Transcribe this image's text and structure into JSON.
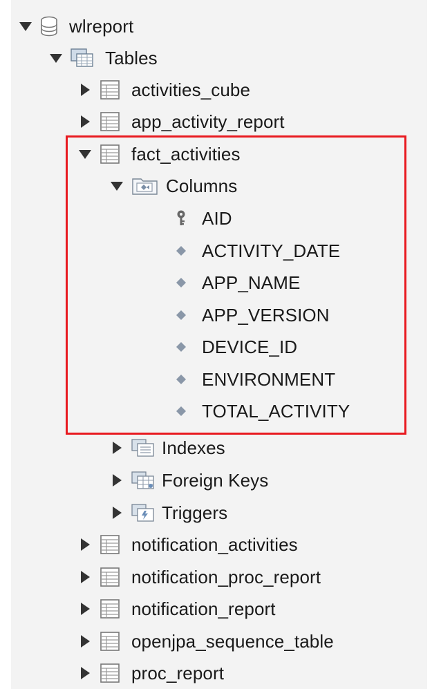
{
  "tree": {
    "database": "wlreport",
    "tables_folder": "Tables",
    "tables_before": [
      "activities_cube",
      "app_activity_report"
    ],
    "expanded_table": "fact_activities",
    "columns_folder": "Columns",
    "columns": [
      {
        "name": "AID",
        "icon": "key-icon"
      },
      {
        "name": "ACTIVITY_DATE",
        "icon": "column-diamond-icon"
      },
      {
        "name": "APP_NAME",
        "icon": "column-diamond-icon"
      },
      {
        "name": "APP_VERSION",
        "icon": "column-diamond-icon"
      },
      {
        "name": "DEVICE_ID",
        "icon": "column-diamond-icon"
      },
      {
        "name": "ENVIRONMENT",
        "icon": "column-diamond-icon"
      },
      {
        "name": "TOTAL_ACTIVITY",
        "icon": "column-diamond-icon"
      }
    ],
    "subfolders": [
      "Indexes",
      "Foreign Keys",
      "Triggers"
    ],
    "tables_after": [
      "notification_activities",
      "notification_proc_report",
      "notification_report",
      "openjpa_sequence_table",
      "proc_report"
    ]
  },
  "colors": {
    "highlight": "#e8191f",
    "background": "#f3f3f3"
  }
}
